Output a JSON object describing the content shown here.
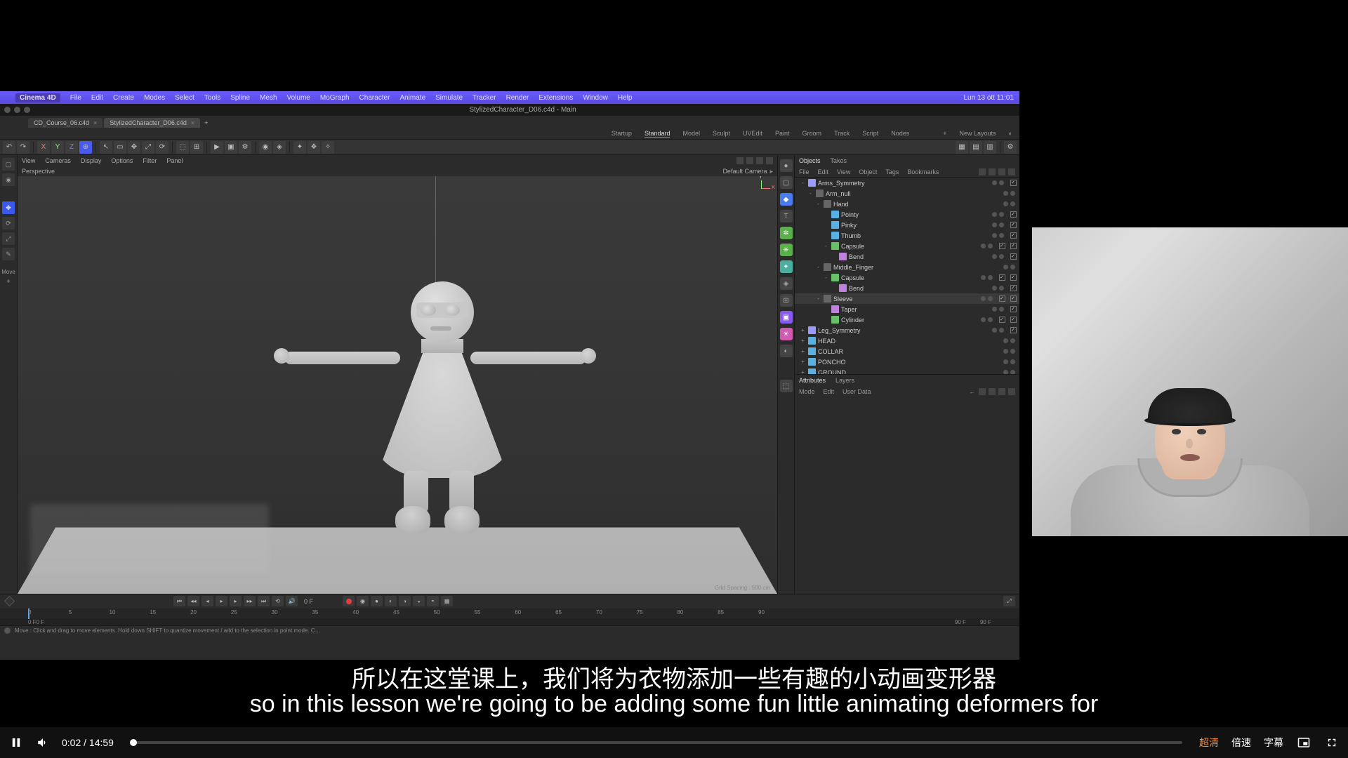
{
  "player": {
    "time": "0:02 / 14:59",
    "hd": "超清",
    "speed": "倍速",
    "caption": "字幕"
  },
  "subtitle": {
    "zh": "所以在这堂课上，我们将为衣物添加一些有趣的小动画变形器",
    "en": "so in this lesson we're going to be adding some fun little animating deformers for"
  },
  "menu": {
    "app": "Cinema 4D",
    "file": "File",
    "edit": "Edit",
    "create": "Create",
    "modes": "Modes",
    "select": "Select",
    "tools": "Tools",
    "spline": "Spline",
    "mesh": "Mesh",
    "volume": "Volume",
    "mograph": "MoGraph",
    "character": "Character",
    "animate": "Animate",
    "simulate": "Simulate",
    "tracker": "Tracker",
    "render": "Render",
    "extensions": "Extensions",
    "window": "Window",
    "help": "Help",
    "clock": "Lun 13 ott  11:01"
  },
  "doc": {
    "title": "StylizedCharacter_D06.c4d - Main",
    "tab1": "CD_Course_06.c4d",
    "tab2": "StylizedCharacter_D06.c4d"
  },
  "layouts": {
    "startup": "Startup",
    "standard": "Standard",
    "model": "Model",
    "sculpt": "Sculpt",
    "uvedit": "UVEdit",
    "paint": "Paint",
    "groom": "Groom",
    "track": "Track",
    "script": "Script",
    "nodes": "Nodes",
    "newlayouts": "New Layouts"
  },
  "viewport": {
    "view": "View",
    "cameras": "Cameras",
    "display": "Display",
    "options": "Options",
    "filter": "Filter",
    "panel": "Panel",
    "label": "Perspective",
    "camera": "Default Camera",
    "grid": "Grid Spacing : 500 cm"
  },
  "leftTool": "Move",
  "objects": {
    "tab_objects": "Objects",
    "tab_takes": "Takes",
    "m_file": "File",
    "m_edit": "Edit",
    "m_view": "View",
    "m_object": "Object",
    "m_tags": "Tags",
    "m_bookmarks": "Bookmarks",
    "tree": [
      {
        "d": 0,
        "exp": "-",
        "ico": "sym",
        "n": "Arms_Symmetry",
        "chk": true
      },
      {
        "d": 1,
        "exp": "-",
        "ico": "null",
        "n": "Arm_null",
        "chk": false
      },
      {
        "d": 2,
        "exp": "-",
        "ico": "null",
        "n": "Hand",
        "chk": false
      },
      {
        "d": 3,
        "exp": "",
        "ico": "mesh",
        "n": "Pointy",
        "chk": true
      },
      {
        "d": 3,
        "exp": "",
        "ico": "mesh",
        "n": "Pinky",
        "chk": true
      },
      {
        "d": 3,
        "exp": "",
        "ico": "mesh",
        "n": "Thumb",
        "chk": true
      },
      {
        "d": 3,
        "exp": "-",
        "ico": "cap",
        "n": "Capsule",
        "chk": true,
        "xtra": true
      },
      {
        "d": 4,
        "exp": "",
        "ico": "def",
        "n": "Bend",
        "chk": true
      },
      {
        "d": 2,
        "exp": "-",
        "ico": "null",
        "n": "Middle_Finger",
        "chk": false
      },
      {
        "d": 3,
        "exp": "-",
        "ico": "cap",
        "n": "Capsule",
        "chk": true,
        "xtra": true
      },
      {
        "d": 4,
        "exp": "",
        "ico": "def",
        "n": "Bend",
        "chk": true
      },
      {
        "d": 2,
        "exp": "-",
        "ico": "null",
        "n": "Sleeve",
        "chk": true,
        "xtra": true,
        "sel": true
      },
      {
        "d": 3,
        "exp": "",
        "ico": "taper",
        "n": "Taper",
        "chk": true
      },
      {
        "d": 3,
        "exp": "",
        "ico": "cyl",
        "n": "Cylinder",
        "chk": true,
        "xtra": true
      },
      {
        "d": 0,
        "exp": "+",
        "ico": "sym",
        "n": "Leg_Symmetry",
        "chk": true
      },
      {
        "d": 0,
        "exp": "+",
        "ico": "mesh",
        "n": "HEAD",
        "chk": false
      },
      {
        "d": 0,
        "exp": "+",
        "ico": "mesh",
        "n": "COLLAR",
        "chk": false
      },
      {
        "d": 0,
        "exp": "+",
        "ico": "mesh",
        "n": "PONCHO",
        "chk": false
      },
      {
        "d": 0,
        "exp": "+",
        "ico": "mesh",
        "n": "GROUND",
        "chk": false
      }
    ]
  },
  "attrs": {
    "tab_attrs": "Attributes",
    "tab_layers": "Layers",
    "m_mode": "Mode",
    "m_edit": "Edit",
    "m_userdata": "User Data"
  },
  "timeline": {
    "frame": "0 F",
    "marks": [
      "0",
      "5",
      "10",
      "15",
      "20",
      "25",
      "30",
      "35",
      "40",
      "45",
      "50",
      "55",
      "60",
      "65",
      "70",
      "75",
      "80",
      "85",
      "90"
    ],
    "range_start": "0 F",
    "range_mid": "0 F",
    "range_end": "90 F",
    "range_end2": "90 F"
  },
  "status": "Move : Click and drag to move elements. Hold down SHIFT to quantize movement / add to the selection in point mode. C…"
}
